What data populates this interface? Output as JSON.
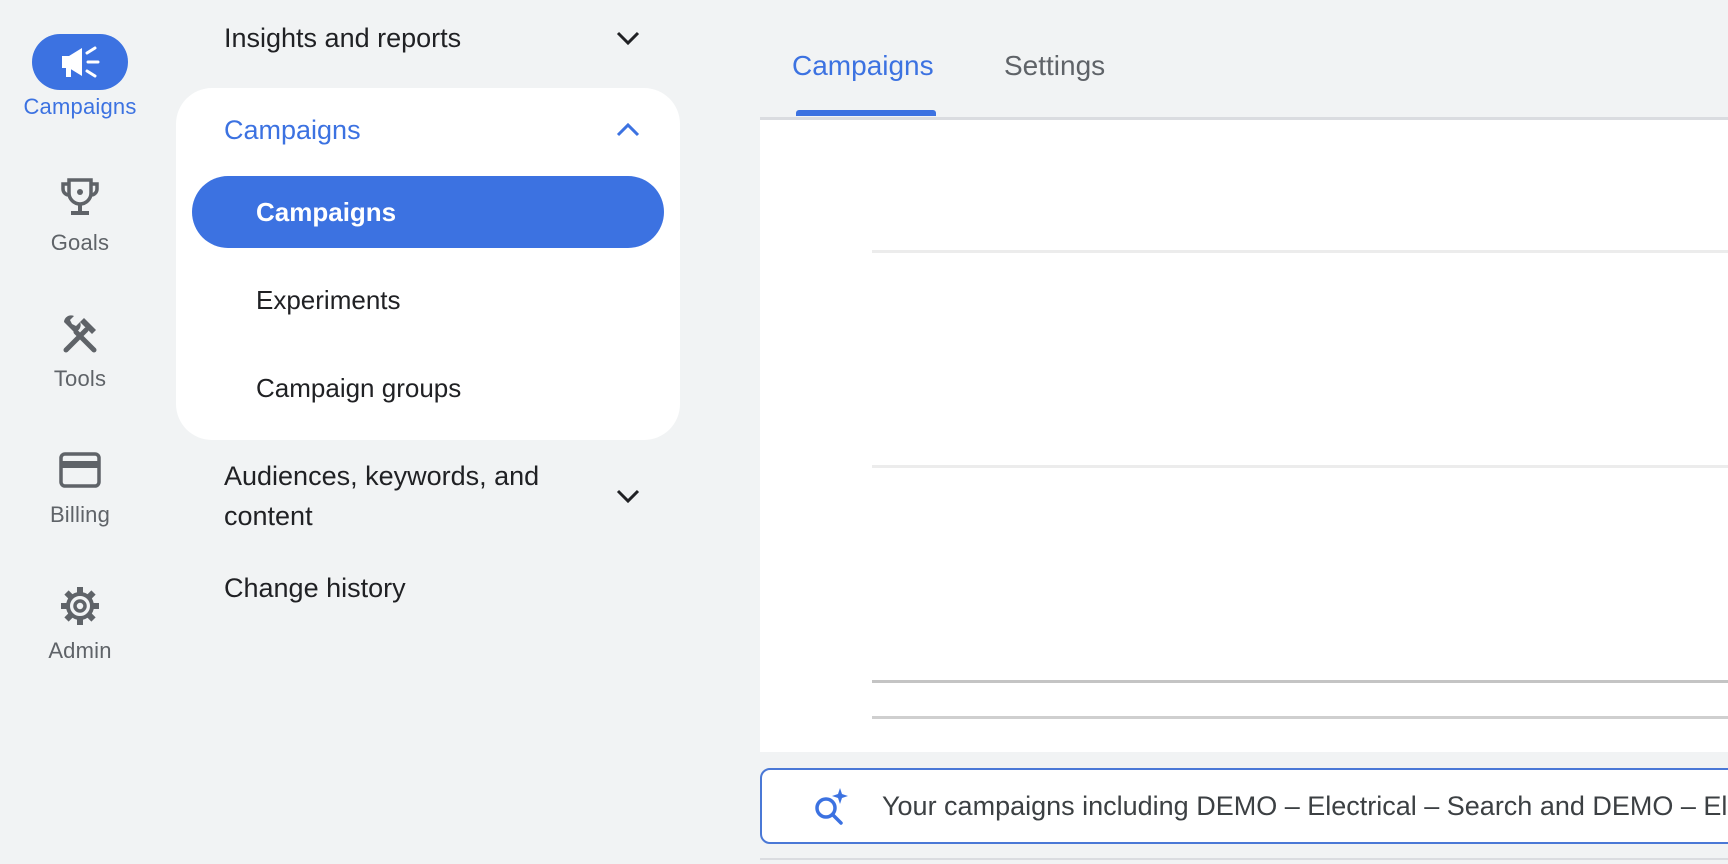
{
  "rail": {
    "items": [
      {
        "label": "Campaigns",
        "icon": "megaphone-icon",
        "active": true
      },
      {
        "label": "Goals",
        "icon": "trophy-icon",
        "active": false
      },
      {
        "label": "Tools",
        "icon": "tools-icon",
        "active": false
      },
      {
        "label": "Billing",
        "icon": "credit-card-icon",
        "active": false
      },
      {
        "label": "Admin",
        "icon": "gear-icon",
        "active": false
      }
    ]
  },
  "nav": {
    "insights": "Insights and reports",
    "campaigns_section": {
      "label": "Campaigns",
      "items": [
        "Campaigns",
        "Experiments",
        "Campaign groups"
      ]
    },
    "audiences": "Audiences, keywords, and content",
    "change_history": "Change history"
  },
  "tabs": [
    "Campaigns",
    "Settings"
  ],
  "summary": {
    "text": "Your campaigns including DEMO – Electrical – Search and DEMO – Electrical – Display"
  },
  "colors": {
    "accent": "#3c72e1",
    "background": "#f1f3f4",
    "card": "#ffffff",
    "text": "#202124",
    "muted": "#5f6368"
  }
}
